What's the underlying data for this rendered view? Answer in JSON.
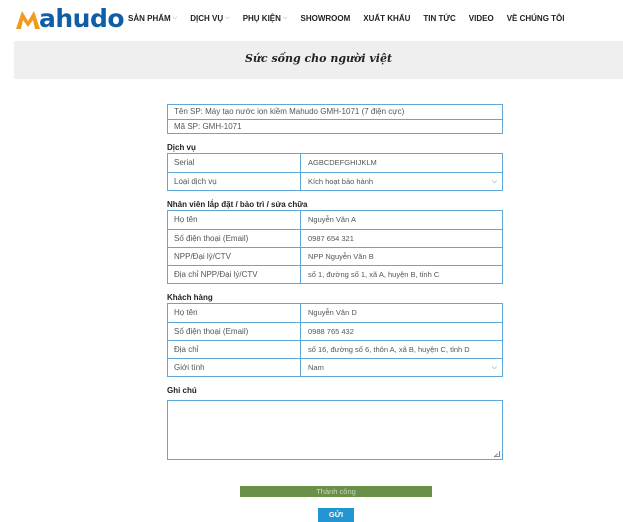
{
  "brand": {
    "logo_text": "ahudo"
  },
  "nav": [
    {
      "label": "SẢN PHẨM",
      "has_dropdown": true
    },
    {
      "label": "DỊCH VỤ",
      "has_dropdown": true
    },
    {
      "label": "PHỤ KIỆN",
      "has_dropdown": true
    },
    {
      "label": "SHOWROOM",
      "has_dropdown": false
    },
    {
      "label": "XUẤT KHẨU",
      "has_dropdown": false
    },
    {
      "label": "TIN TỨC",
      "has_dropdown": false
    },
    {
      "label": "VIDEO",
      "has_dropdown": false
    },
    {
      "label": "VỀ CHÚNG TÔI",
      "has_dropdown": false
    }
  ],
  "banner": {
    "slogan": "Sức sống cho người việt"
  },
  "product": {
    "name": "Tên SP: Máy tạo nước ion kiềm Mahudo GMH-1071 (7 điện cực)",
    "code": "Mã SP: GMH-1071"
  },
  "service": {
    "title": "Dịch vụ",
    "serial_label": "Serial",
    "serial_value": "AGBCDEFGHIJKLM",
    "type_label": "Loại dịch vụ",
    "type_value": "Kích hoạt bảo hành"
  },
  "staff": {
    "title": "Nhân viên lắp đặt / bảo trì / sửa chữa",
    "name_label": "Họ tên",
    "name_value": "Nguyễn Văn A",
    "phone_label": "Số điện thoại (Email)",
    "phone_value": "0987 654 321",
    "dealer_label": "NPP/Đại lý/CTV",
    "dealer_value": "NPP Nguyễn Văn B",
    "dealer_address_label": "Địa chỉ NPP/Đại lý/CTV",
    "dealer_address_value": "số 1, đường số 1, xã A, huyện B, tỉnh C"
  },
  "customer": {
    "title": "Khách hàng",
    "name_label": "Họ tên",
    "name_value": "Nguyễn Văn D",
    "phone_label": "Số điện thoại (Email)",
    "phone_value": "0988 765 432",
    "address_label": "Địa chỉ",
    "address_value": "số 16, đường số 6, thôn A, xã B, huyện C, tỉnh D",
    "gender_label": "Giới tính",
    "gender_value": "Nam"
  },
  "note": {
    "title": "Ghi chú",
    "value": ""
  },
  "status": {
    "message": "Thành công"
  },
  "actions": {
    "submit_label": "GỬI"
  },
  "colors": {
    "brand_blue": "#0e5fa8",
    "brand_orange": "#f39a1e",
    "border_blue": "#5fa7d9",
    "success_green": "#6a8f48",
    "button_blue": "#2196d3",
    "banner_gray": "#efefef"
  }
}
